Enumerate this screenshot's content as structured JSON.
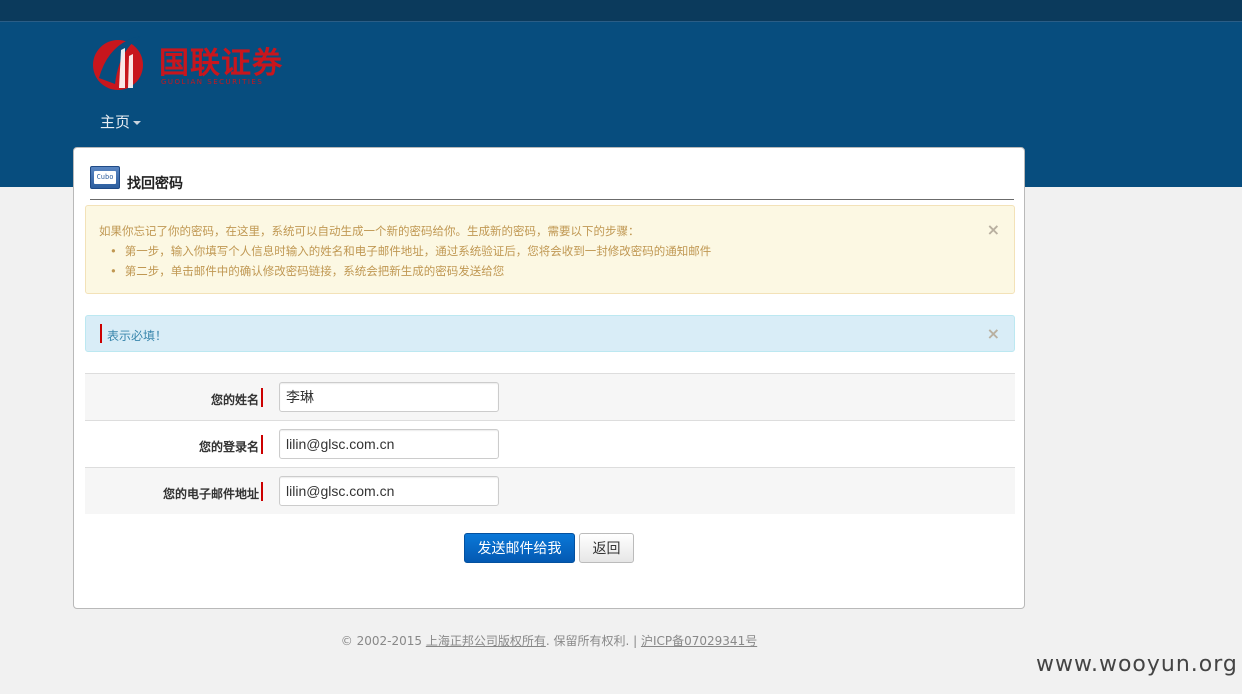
{
  "header": {
    "logo_text": "国联证券",
    "logo_subtext": "GUOLIAN SECURITIES",
    "nav_home": "主页"
  },
  "card": {
    "title": "找回密码",
    "icon_text": "Cubo",
    "warning": {
      "intro": "如果你忘记了你的密码，在这里，系统可以自动生成一个新的密码给你。生成新的密码，需要以下的步骤：",
      "steps": [
        "第一步，输入你填写个人信息时输入的姓名和电子邮件地址，通过系统验证后，您将会收到一封修改密码的通知邮件",
        "第二步，单击邮件中的确认修改密码链接，系统会把新生成的密码发送给您"
      ],
      "close": "×"
    },
    "info": {
      "text": "表示必填！",
      "close": "×"
    },
    "form": {
      "name_label": "您的姓名",
      "name_value": "李琳",
      "login_label": "您的登录名",
      "login_value": "lilin@glsc.com.cn",
      "email_label": "您的电子邮件地址",
      "email_value": "lilin@glsc.com.cn"
    },
    "buttons": {
      "send": "发送邮件给我",
      "back": "返回"
    }
  },
  "footer": {
    "copyright": "© 2002-2015 ",
    "company_link": "上海正邦公司版权所有",
    "rights": ". 保留所有权利. | ",
    "icp_link": "沪ICP备07029341号"
  },
  "watermark": "www.wooyun.org",
  "colors": {
    "header_bg": "#074d7e",
    "brand_red": "#c8161d",
    "primary_button": "#0a6fd0"
  }
}
